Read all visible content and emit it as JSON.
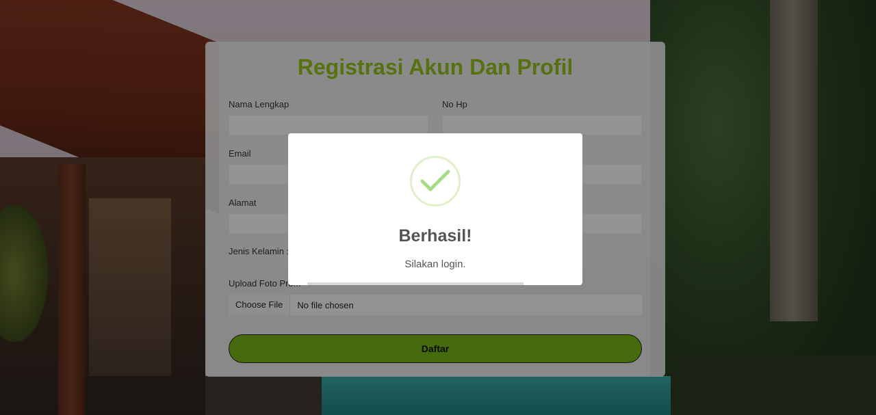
{
  "form": {
    "title": "Registrasi Akun Dan Profil",
    "labels": {
      "nama": "Nama Lengkap",
      "hp": "No Hp",
      "email": "Email",
      "alamat": "Alamat",
      "jenis_kelamin": "Jenis Kelamin :",
      "upload": "Upload Foto Pro..."
    },
    "file_input": {
      "button": "Choose File",
      "status": "No file chosen"
    },
    "submit_label": "Daftar"
  },
  "dialog": {
    "icon": "check-icon",
    "title": "Berhasil!",
    "message": "Silakan login."
  },
  "colors": {
    "title_green": "#8fbf1a",
    "button_green": "#74b214",
    "check_green": "#a5dc86"
  }
}
